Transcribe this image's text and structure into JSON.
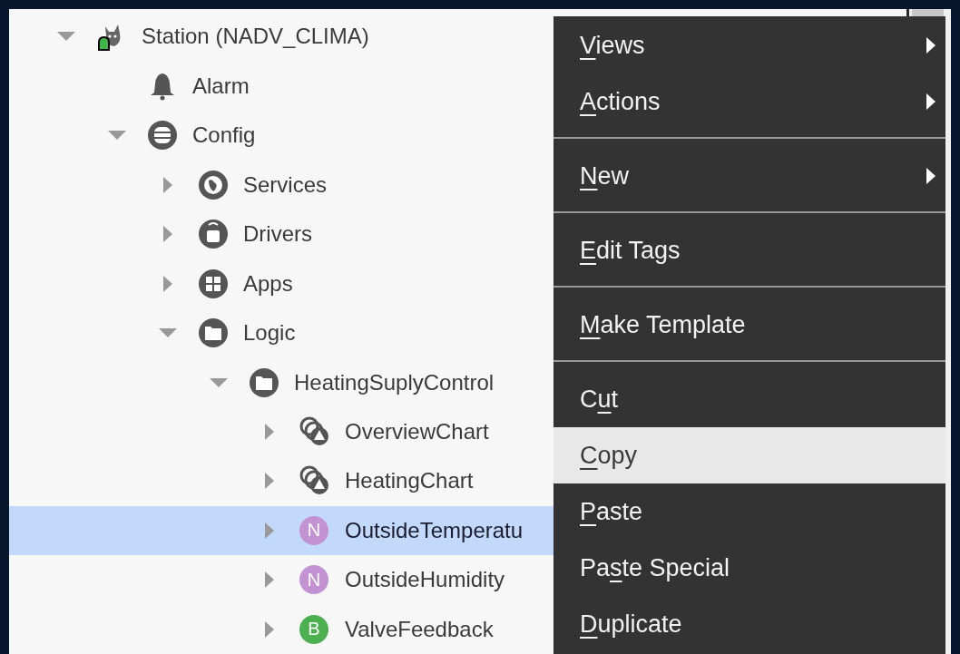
{
  "tree": [
    {
      "label": "Station (NADV_CLIMA)",
      "kind": "station",
      "expanded": true,
      "selected": false,
      "children": [
        {
          "label": "Alarm",
          "kind": "alarm",
          "selected": false
        },
        {
          "label": "Config",
          "kind": "config",
          "expanded": true,
          "selected": false,
          "children": [
            {
              "label": "Services",
              "kind": "services",
              "expanded": false,
              "selected": false
            },
            {
              "label": "Drivers",
              "kind": "drivers",
              "expanded": false,
              "selected": false
            },
            {
              "label": "Apps",
              "kind": "apps",
              "expanded": false,
              "selected": false
            },
            {
              "label": "Logic",
              "kind": "folder",
              "expanded": true,
              "selected": false,
              "children": [
                {
                  "label": "HeatingSuplyControl",
                  "kind": "folder",
                  "expanded": true,
                  "selected": false,
                  "children": [
                    {
                      "label": "OverviewChart",
                      "kind": "chart",
                      "expanded": false,
                      "selected": false
                    },
                    {
                      "label": "HeatingChart",
                      "kind": "chart",
                      "expanded": false,
                      "selected": false
                    },
                    {
                      "label": "OutsideTemperatu",
                      "kind": "badge",
                      "badge": "N",
                      "color": "#c392d2",
                      "expanded": false,
                      "selected": true
                    },
                    {
                      "label": "OutsideHumidity",
                      "kind": "badge",
                      "badge": "N",
                      "color": "#c392d2",
                      "expanded": false,
                      "selected": false
                    },
                    {
                      "label": "ValveFeedback",
                      "kind": "badge",
                      "badge": "B",
                      "color": "#4caf50",
                      "expanded": false,
                      "selected": false
                    }
                  ]
                }
              ]
            }
          ]
        }
      ]
    }
  ],
  "context_menu": {
    "groups": [
      [
        {
          "label": [
            {
              "text": "V",
              "underlined": true
            },
            {
              "text": "iews",
              "underlined": false
            }
          ],
          "submenu": true,
          "selected": false
        },
        {
          "label": [
            {
              "text": "A",
              "underlined": true
            },
            {
              "text": "ctions",
              "underlined": false
            }
          ],
          "submenu": true,
          "selected": false
        }
      ],
      [
        {
          "label": [
            {
              "text": "N",
              "underlined": true
            },
            {
              "text": "ew",
              "underlined": false
            }
          ],
          "submenu": true,
          "selected": false
        }
      ],
      [
        {
          "label": [
            {
              "text": "E",
              "underlined": true
            },
            {
              "text": "dit Tags",
              "underlined": false
            }
          ],
          "submenu": false,
          "selected": false
        }
      ],
      [
        {
          "label": [
            {
              "text": "M",
              "underlined": true
            },
            {
              "text": "ake Template",
              "underlined": false
            }
          ],
          "submenu": false,
          "selected": false
        }
      ],
      [
        {
          "label": [
            {
              "text": "C",
              "underlined": false
            },
            {
              "text": "u",
              "underlined": true
            },
            {
              "text": "t",
              "underlined": false
            }
          ],
          "submenu": false,
          "selected": false
        },
        {
          "label": [
            {
              "text": "C",
              "underlined": true
            },
            {
              "text": "opy",
              "underlined": false
            }
          ],
          "submenu": false,
          "selected": true
        },
        {
          "label": [
            {
              "text": "P",
              "underlined": true
            },
            {
              "text": "aste",
              "underlined": false
            }
          ],
          "submenu": false,
          "selected": false
        },
        {
          "label": [
            {
              "text": "Pa",
              "underlined": false
            },
            {
              "text": "s",
              "underlined": true
            },
            {
              "text": "te Special",
              "underlined": false
            }
          ],
          "submenu": false,
          "selected": false
        },
        {
          "label": [
            {
              "text": "D",
              "underlined": true
            },
            {
              "text": "uplicate",
              "underlined": false
            }
          ],
          "submenu": false,
          "selected": false
        }
      ]
    ]
  }
}
